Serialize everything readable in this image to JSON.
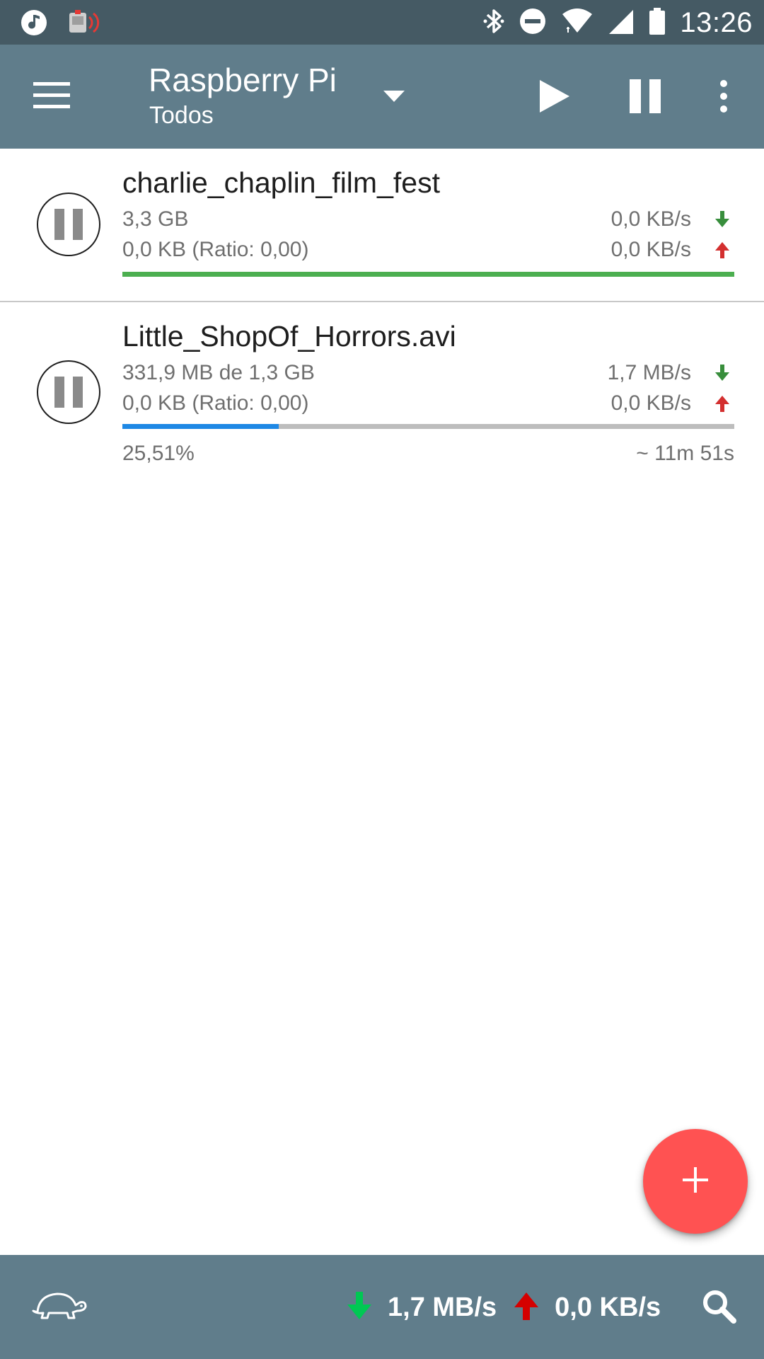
{
  "status_bar": {
    "time": "13:26",
    "icons": [
      "music-note-icon",
      "cast-screen-icon",
      "bluetooth-icon",
      "do-not-disturb-icon",
      "wifi-icon",
      "signal-icon",
      "battery-icon"
    ]
  },
  "app_bar": {
    "title": "Raspberry Pi",
    "subtitle": "Todos",
    "icons": [
      "menu-icon",
      "dropdown-arrow-icon",
      "play-icon",
      "pause-icon",
      "more-vert-icon"
    ],
    "background": "#607d8b"
  },
  "torrents": [
    {
      "name": "charlie_chaplin_film_fest",
      "size": "3,3 GB",
      "uploaded": "0,0 KB (Ratio: 0,00)",
      "download_speed": "0,0 KB/s",
      "upload_speed": "0,0 KB/s",
      "progress": 1.0,
      "progress_color": "#4caf50"
    },
    {
      "name": "Little_ShopOf_Horrors.avi",
      "size": "331,9 MB de 1,3 GB",
      "uploaded": "0,0 KB (Ratio: 0,00)",
      "download_speed": "1,7 MB/s",
      "upload_speed": "0,0 KB/s",
      "progress": 0.2551,
      "progress_color": "#1e88e5",
      "percent": "25,51%",
      "eta": "~ 11m 51s"
    }
  ],
  "colors": {
    "download_arrow": "#388e3c",
    "upload_arrow": "#d32f2f",
    "fab": "#ff5252",
    "bottom_download_arrow": "#00c853",
    "bottom_upload_arrow": "#d50000"
  },
  "fab": {
    "icon": "plus-icon"
  },
  "bottom_bar": {
    "download_speed": "1,7 MB/s",
    "upload_speed": "0,0 KB/s",
    "icons": [
      "turtle-icon",
      "download-arrow-icon",
      "upload-arrow-icon",
      "search-icon"
    ]
  }
}
